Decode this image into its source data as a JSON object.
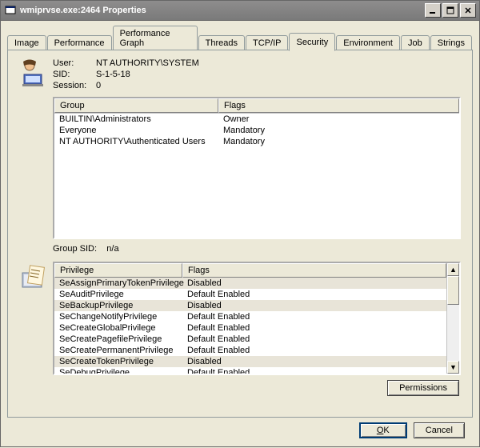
{
  "window": {
    "title": "wmiprvse.exe:2464 Properties"
  },
  "tabs": {
    "t0": "Image",
    "t1": "Performance",
    "t2": "Performance Graph",
    "t3": "Threads",
    "t4": "TCP/IP",
    "t5": "Security",
    "t6": "Environment",
    "t7": "Job",
    "t8": "Strings"
  },
  "info": {
    "user_label": "User:",
    "user_value": "NT AUTHORITY\\SYSTEM",
    "sid_label": "SID:",
    "sid_value": "S-1-5-18",
    "session_label": "Session:",
    "session_value": "0"
  },
  "group_table": {
    "col_group": "Group",
    "col_flags": "Flags",
    "rows": {
      "r0": {
        "group": "BUILTIN\\Administrators",
        "flags": "Owner"
      },
      "r1": {
        "group": "Everyone",
        "flags": "Mandatory"
      },
      "r2": {
        "group": "NT AUTHORITY\\Authenticated Users",
        "flags": "Mandatory"
      }
    }
  },
  "group_sid": {
    "label": "Group SID:",
    "value": "n/a"
  },
  "priv_table": {
    "col_priv": "Privilege",
    "col_flags": "Flags",
    "rows": {
      "r0": {
        "priv": "SeAssignPrimaryTokenPrivilege",
        "flags": "Disabled",
        "shade": true
      },
      "r1": {
        "priv": "SeAuditPrivilege",
        "flags": "Default Enabled",
        "shade": false
      },
      "r2": {
        "priv": "SeBackupPrivilege",
        "flags": "Disabled",
        "shade": true
      },
      "r3": {
        "priv": "SeChangeNotifyPrivilege",
        "flags": "Default Enabled",
        "shade": false
      },
      "r4": {
        "priv": "SeCreateGlobalPrivilege",
        "flags": "Default Enabled",
        "shade": false
      },
      "r5": {
        "priv": "SeCreatePagefilePrivilege",
        "flags": "Default Enabled",
        "shade": false
      },
      "r6": {
        "priv": "SeCreatePermanentPrivilege",
        "flags": "Default Enabled",
        "shade": false
      },
      "r7": {
        "priv": "SeCreateTokenPrivilege",
        "flags": "Disabled",
        "shade": true
      },
      "r8": {
        "priv": "SeDebugPrivilege",
        "flags": "Default Enabled",
        "shade": false
      }
    }
  },
  "buttons": {
    "permissions": "Permissions",
    "ok": "OK",
    "cancel": "Cancel"
  }
}
